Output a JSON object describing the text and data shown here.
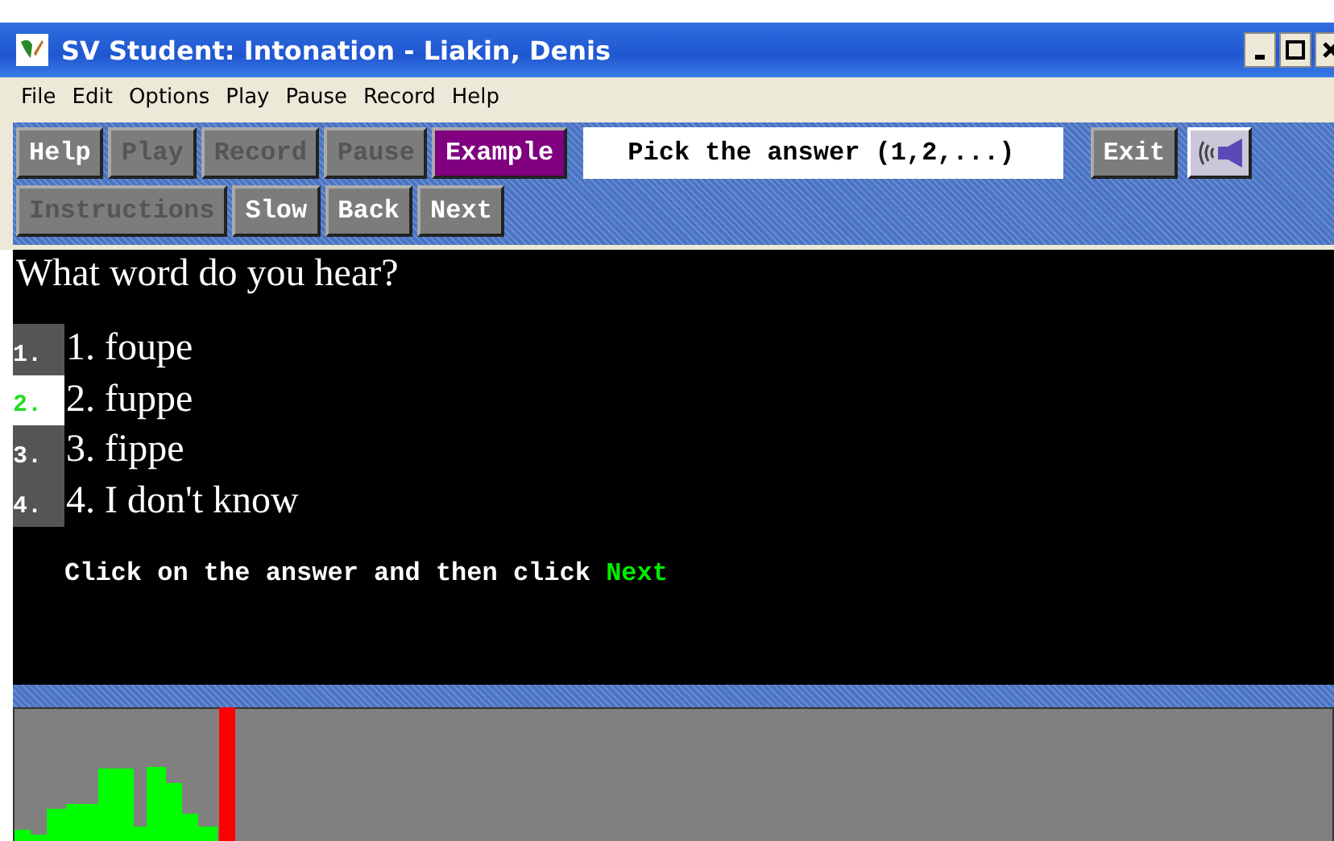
{
  "window": {
    "title": "SV Student: Intonation - Liakin, Denis"
  },
  "menu": [
    "File",
    "Edit",
    "Options",
    "Play",
    "Pause",
    "Record",
    "Help"
  ],
  "toolbar_row_1": [
    {
      "label": "Help",
      "disabled": false,
      "highlighted": false
    },
    {
      "label": "Play",
      "disabled": true,
      "highlighted": false
    },
    {
      "label": "Record",
      "disabled": true,
      "highlighted": false
    },
    {
      "label": "Pause",
      "disabled": true,
      "highlighted": false
    },
    {
      "label": "Example",
      "disabled": false,
      "highlighted": true
    }
  ],
  "prompt": "Pick the answer (1,2,...)",
  "exit_button": "Exit",
  "toolbar_row_2": [
    {
      "label": "Instructions",
      "disabled": true,
      "highlighted": false
    },
    {
      "label": "Slow",
      "disabled": false,
      "highlighted": false
    },
    {
      "label": "Back",
      "disabled": false,
      "highlighted": false
    },
    {
      "label": "Next",
      "disabled": false,
      "highlighted": false
    }
  ],
  "question": "What word do you hear?",
  "answers": [
    {
      "number": "1.",
      "text": "1. foupe",
      "selected": false
    },
    {
      "number": "2.",
      "text": "2. fuppe",
      "selected": true
    },
    {
      "number": "3.",
      "text": "3. fippe",
      "selected": false
    },
    {
      "number": "4.",
      "text": "4. I don't know",
      "selected": false
    }
  ],
  "instruction": "Click on the answer and then click **Next**"
}
